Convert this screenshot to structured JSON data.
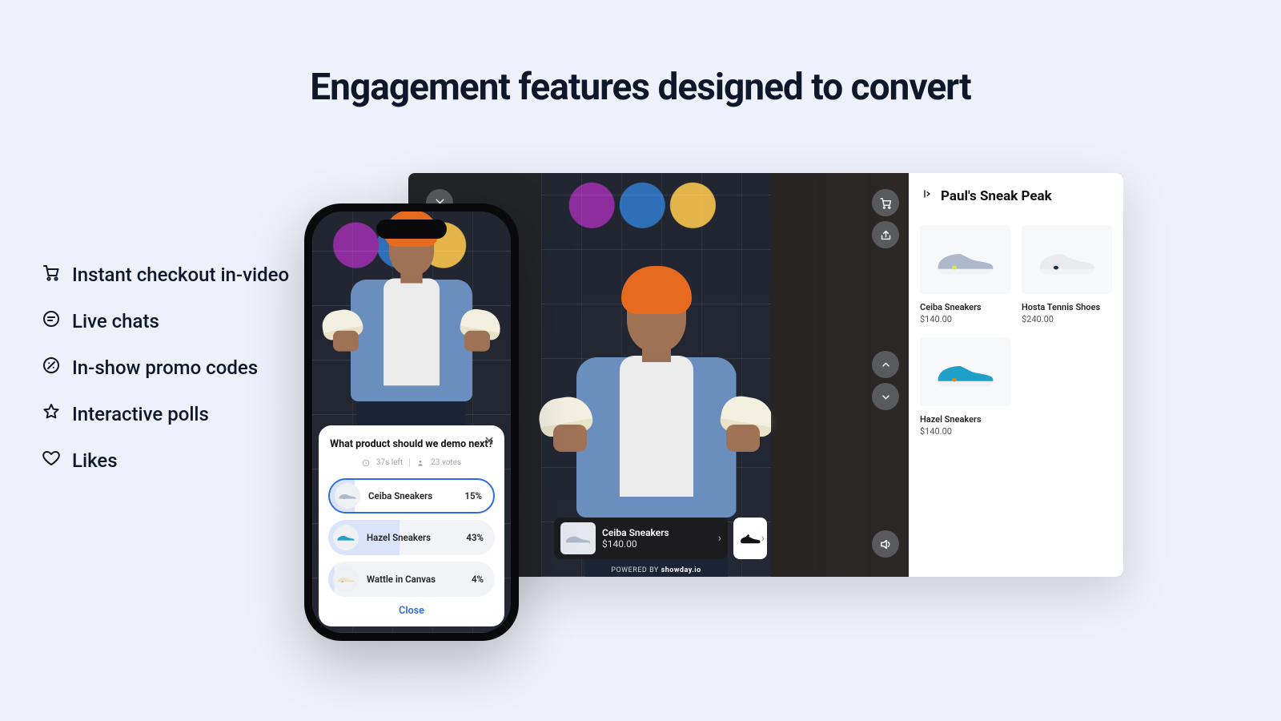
{
  "headline": "Engagement features designed to convert",
  "features": [
    {
      "icon": "cart",
      "label": "Instant checkout in-video"
    },
    {
      "icon": "chat",
      "label": "Live chats"
    },
    {
      "icon": "promo",
      "label": "In-show promo codes"
    },
    {
      "icon": "star",
      "label": "Interactive polls"
    },
    {
      "icon": "heart",
      "label": "Likes"
    }
  ],
  "desktop": {
    "stream_title": "Paul's Sneak Peak",
    "featured_product": {
      "name": "Ceiba Sneakers",
      "price": "$140.00"
    },
    "powered_by_prefix": "POWERED BY ",
    "powered_by_brand": "showday.io",
    "products": [
      {
        "name": "Ceiba Sneakers",
        "price": "$140.00",
        "color": "#aeb8cd",
        "accent": "#d7e84c"
      },
      {
        "name": "Hosta Tennis Shoes",
        "price": "$240.00",
        "color": "#e9ebee",
        "accent": "#203040"
      },
      {
        "name": "Hazel Sneakers",
        "price": "$140.00",
        "color": "#1ea0c8",
        "accent": "#d48a2e"
      }
    ]
  },
  "poll": {
    "question": "What product should we demo next?",
    "time_left": "37s left",
    "votes": "23 votes",
    "options": [
      {
        "label": "Ceiba Sneakers",
        "pct": "15%",
        "fill": 15,
        "selected": true,
        "thumb_color": "#aeb8cd"
      },
      {
        "label": "Hazel Sneakers",
        "pct": "43%",
        "fill": 43,
        "selected": false,
        "thumb_color": "#1ea0c8"
      },
      {
        "label": "Wattle in Canvas",
        "pct": "4%",
        "fill": 4,
        "selected": false,
        "thumb_color": "#efe3c6"
      }
    ],
    "close_label": "Close"
  }
}
